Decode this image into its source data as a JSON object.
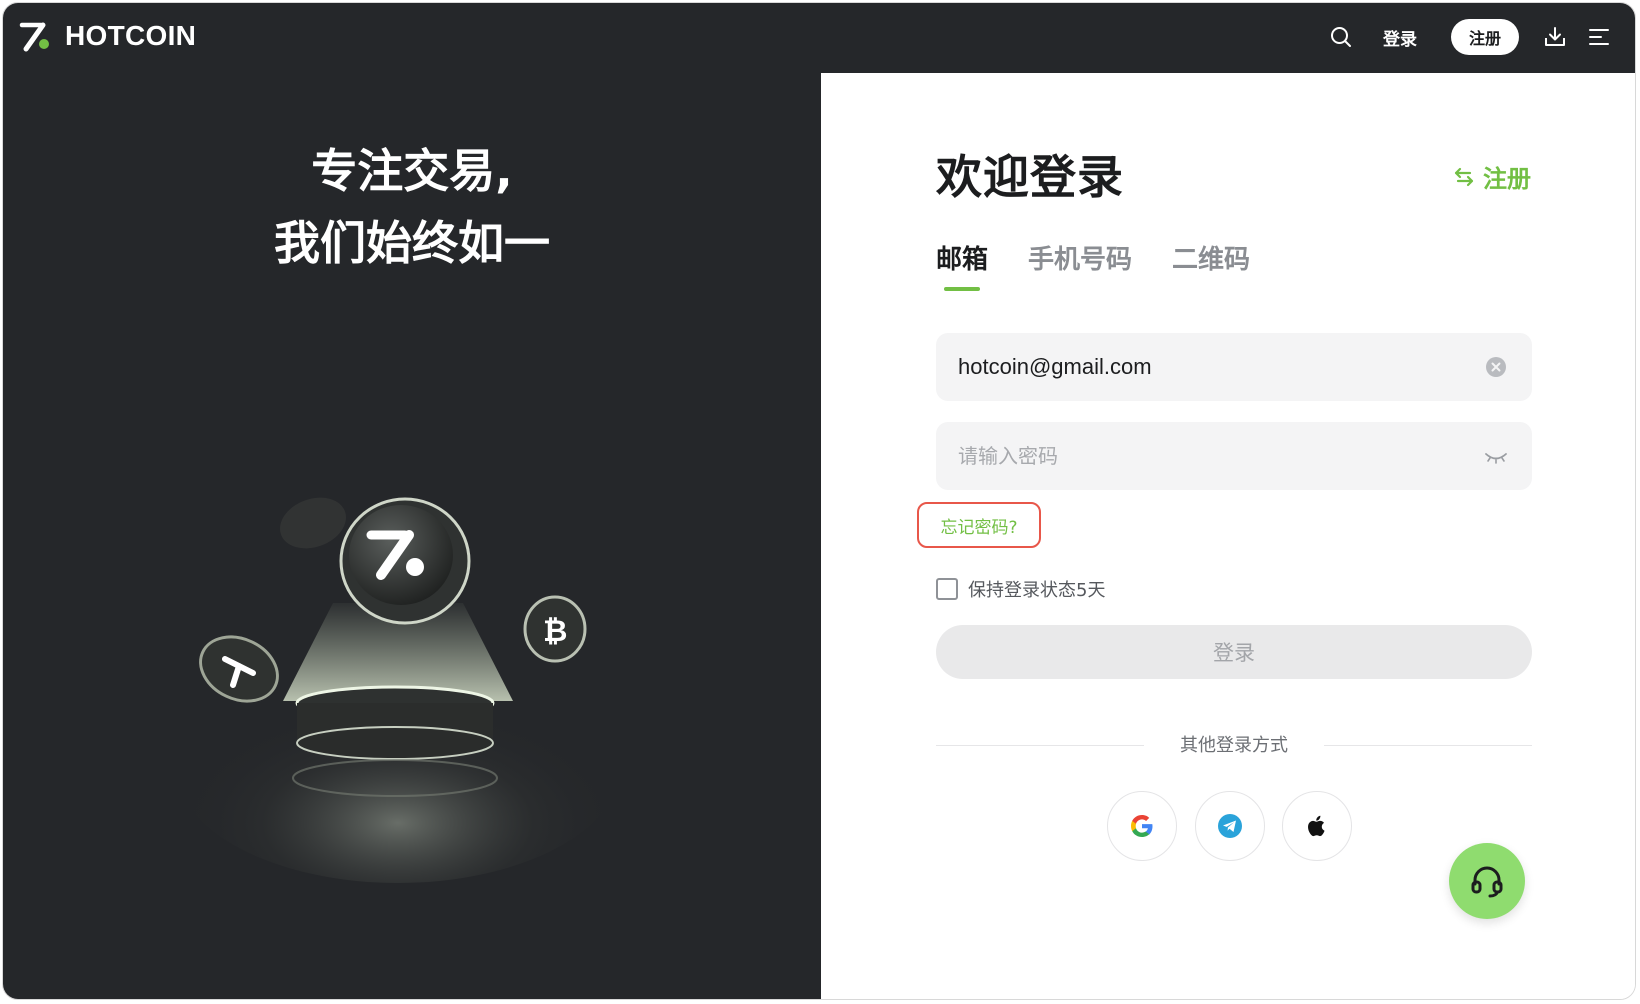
{
  "header": {
    "brand": "HOTCOIN",
    "login_label": "登录",
    "register_label": "注册"
  },
  "hero": {
    "line1": "专注交易,",
    "line2": "我们始终如一"
  },
  "login": {
    "title": "欢迎登录",
    "switch_register": "注册",
    "tabs": [
      "邮箱",
      "手机号码",
      "二维码"
    ],
    "active_tab": "邮箱",
    "email_value": "hotcoin@gmail.com",
    "password_placeholder": "请输入密码",
    "forgot_label": "忘记密码?",
    "remember_label": "保持登录状态5天",
    "remember_checked": false,
    "submit_label": "登录",
    "other_methods_label": "其他登录方式"
  },
  "colors": {
    "accent": "#72bf44",
    "header_bg": "#25272a",
    "highlight_border": "#e8574a",
    "support_bg": "#8fdc6f"
  },
  "icons": {
    "header": [
      "search-icon",
      "download-icon",
      "menu-icon"
    ],
    "social": [
      "google-icon",
      "telegram-icon",
      "apple-icon"
    ],
    "support": "headset-icon"
  }
}
